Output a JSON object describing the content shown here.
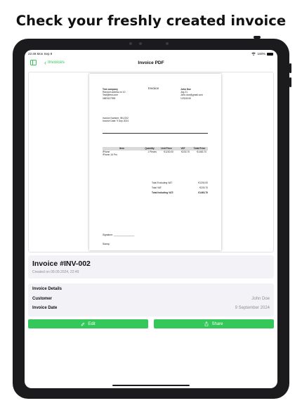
{
  "headline": "Check your freshly created invoice",
  "status_bar": {
    "time": "22:49  Mon Sep 9",
    "battery": "100%"
  },
  "nav": {
    "back_label": "Invoices",
    "title": "Invoice PDF"
  },
  "pdf": {
    "seller": {
      "name": "Test company",
      "address": "Random adress no 10",
      "email": "Test@test.com",
      "phone": "0687627999"
    },
    "doc_title": "Invoice",
    "buyer": {
      "name": "John Doe",
      "address": "Jog 21",
      "email": "John.doe@gmail.com",
      "phone": "12324245"
    },
    "invoice_number": "Invoice Number: INV-002",
    "invoice_date": "Invoice Date: 9 Sep 2024",
    "table": {
      "headers": [
        "Item",
        "Quantity",
        "Unit Price",
        "VAT",
        "Total Price"
      ],
      "rows": [
        {
          "item_line1": "iPhone",
          "item_line2": "iPhone 16 Pro",
          "quantity": "1 Pieces",
          "unit_price": "€1230.00",
          "vat": "€233.70",
          "total": "€1463.70"
        }
      ]
    },
    "totals": [
      {
        "label": "Total Excluding VAT:",
        "value": "€1230.00"
      },
      {
        "label": "Total VAT:",
        "value": "€233.70"
      },
      {
        "label": "Total Including VAT:",
        "value": "€1463.70"
      }
    ],
    "signature_label": "Signature: ________________",
    "stamp_label": "Stamp:"
  },
  "invoice_header": {
    "title": "Invoice #INV-002",
    "created": "Created on 09.09.2024, 22:49"
  },
  "details": {
    "section_title": "Invoice Details",
    "customer_label": "Customer",
    "customer_value": "John Doe",
    "date_label": "Invoice Date",
    "date_value": "9 September 2024"
  },
  "actions": {
    "edit_label": "Edit",
    "share_label": "Share"
  },
  "colors": {
    "accent": "#34c759",
    "card_bg": "#f2f2f7",
    "secondary_text": "#8e8e93"
  }
}
